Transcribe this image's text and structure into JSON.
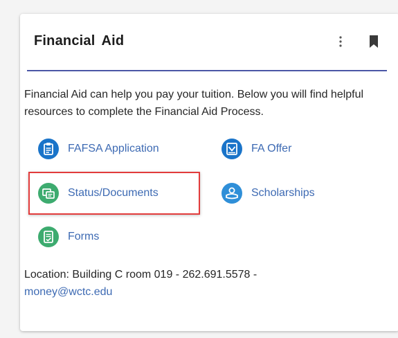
{
  "card": {
    "title": "Financial Aid",
    "menu_icon": "more-vertical-icon",
    "bookmark_icon": "bookmark-icon",
    "accent_color": "#4a56a6"
  },
  "description": "Financial Aid can help you pay your tuition. Below you will find helpful resources to complete the Financial Aid Process.",
  "links": [
    {
      "label": "FAFSA Application",
      "icon": "clipboard-icon",
      "icon_color": "#1a74c9"
    },
    {
      "label": "FA Offer",
      "icon": "award-document-icon",
      "icon_color": "#1a74c9"
    },
    {
      "label": "Status/Documents",
      "icon": "documents-icon",
      "icon_color": "#3dab6f"
    },
    {
      "label": "Scholarships",
      "icon": "graduate-hand-icon",
      "icon_color": "#2f8fd8"
    },
    {
      "label": "Forms",
      "icon": "form-check-icon",
      "icon_color": "#3dab6f"
    }
  ],
  "location": {
    "prefix": "Location: Building C room 019 - 262.691.5578 -",
    "email": "money@wctc.edu"
  },
  "highlight_color": "#e23b3b"
}
